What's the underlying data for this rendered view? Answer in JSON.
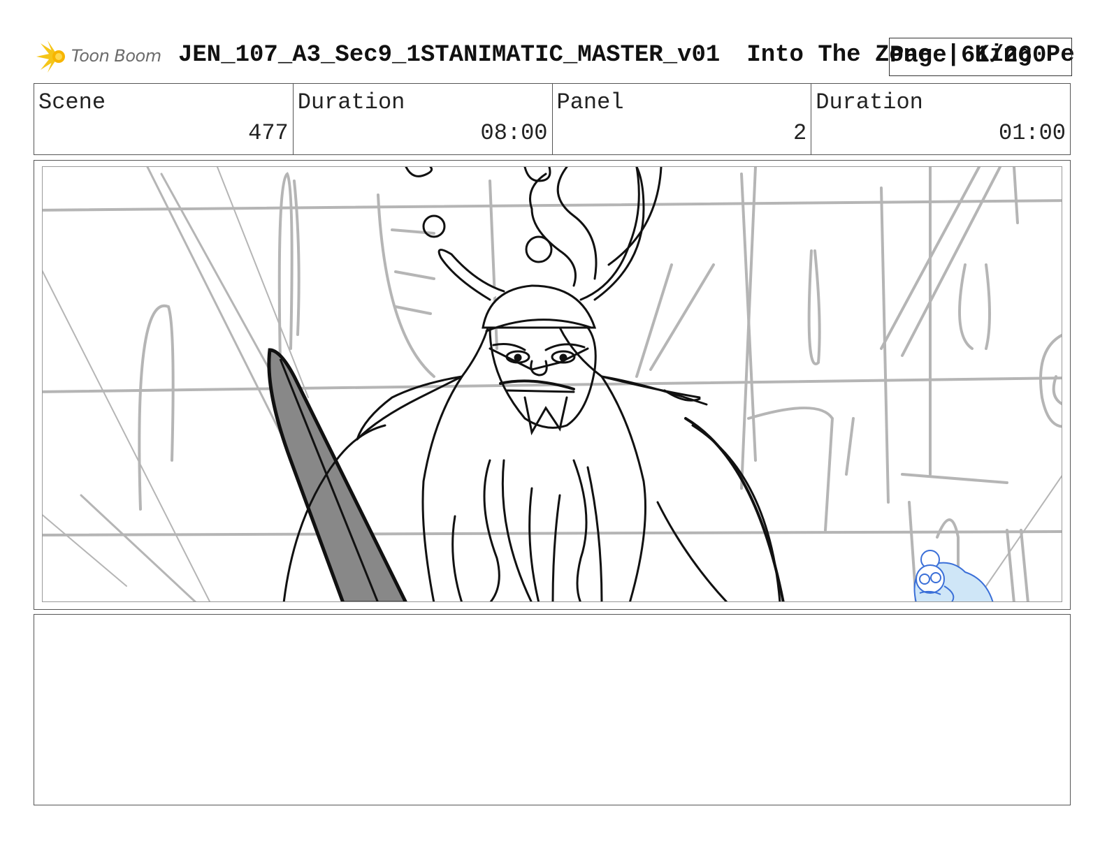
{
  "header": {
    "logo_text": "Toon Boom",
    "project_title": "JEN_107_A3_Sec9_1STANIMATIC_MASTER_v01",
    "subtitle": "Into The Zone | King Pe",
    "page_label": "Page 61/260"
  },
  "info": {
    "scene_label": "Scene",
    "scene_value": "477",
    "scene_duration_label": "Duration",
    "scene_duration_value": "08:00",
    "panel_label": "Panel",
    "panel_value": "2",
    "panel_duration_label": "Duration",
    "panel_duration_value": "01:00"
  },
  "colors": {
    "logo_accent": "#F5C518",
    "sketch_grey": "#b5b5b5",
    "ink": "#111111",
    "blue_sketch": "#3a6fd8",
    "blue_fill": "#cfe6f7"
  },
  "notes": {
    "text": ""
  }
}
